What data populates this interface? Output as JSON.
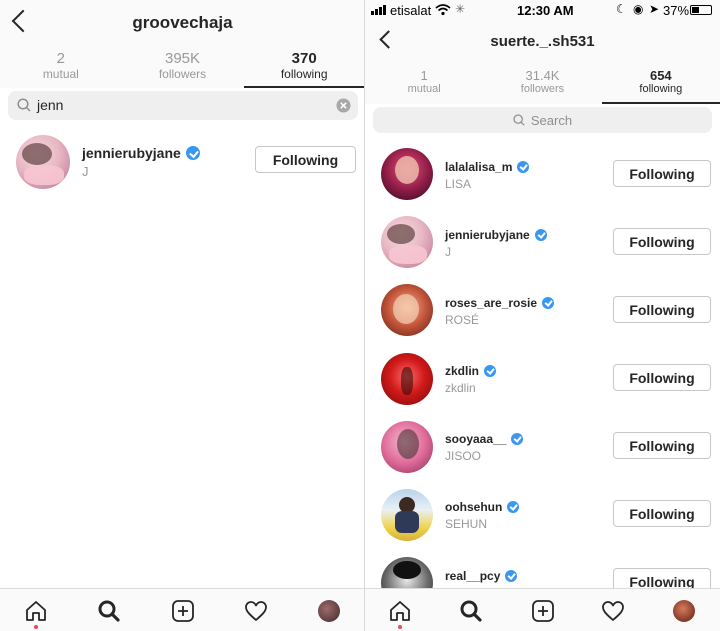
{
  "left": {
    "title": "groovechaja",
    "tabs": [
      {
        "num": "2",
        "label": "mutual"
      },
      {
        "num": "395K",
        "label": "followers"
      },
      {
        "num": "370",
        "label": "following"
      }
    ],
    "search_value": "jenn",
    "results": [
      {
        "username": "jennierubyjane",
        "fullname": "J",
        "button": "Following",
        "verified": true
      }
    ]
  },
  "right": {
    "status": {
      "carrier": "etisalat",
      "time": "12:30 AM",
      "battery": "37%"
    },
    "title": "suerte._.sh531",
    "tabs": [
      {
        "num": "1",
        "label": "mutual"
      },
      {
        "num": "31.4K",
        "label": "followers"
      },
      {
        "num": "654",
        "label": "following"
      }
    ],
    "search_placeholder": "Search",
    "users": [
      {
        "username": "lalalalisa_m",
        "fullname": "LISA",
        "button": "Following",
        "verified": true
      },
      {
        "username": "jennierubyjane",
        "fullname": "J",
        "button": "Following",
        "verified": true
      },
      {
        "username": "roses_are_rosie",
        "fullname": "ROSÉ",
        "button": "Following",
        "verified": true
      },
      {
        "username": "zkdlin",
        "fullname": "zkdlin",
        "button": "Following",
        "verified": true
      },
      {
        "username": "sooyaaa__",
        "fullname": "JISOO",
        "button": "Following",
        "verified": true
      },
      {
        "username": "oohsehun",
        "fullname": "SEHUN",
        "button": "Following",
        "verified": true
      },
      {
        "username": "real__pcy",
        "fullname": "",
        "button": "Following",
        "verified": true
      }
    ]
  },
  "icons": {
    "home": "home-icon",
    "search": "search-icon",
    "add": "add-post-icon",
    "activity": "heart-icon",
    "profile": "profile-avatar-icon"
  },
  "colors": {
    "verified": "#3897f0",
    "notification_dot": "#ed4956",
    "muted_text": "#999999"
  }
}
